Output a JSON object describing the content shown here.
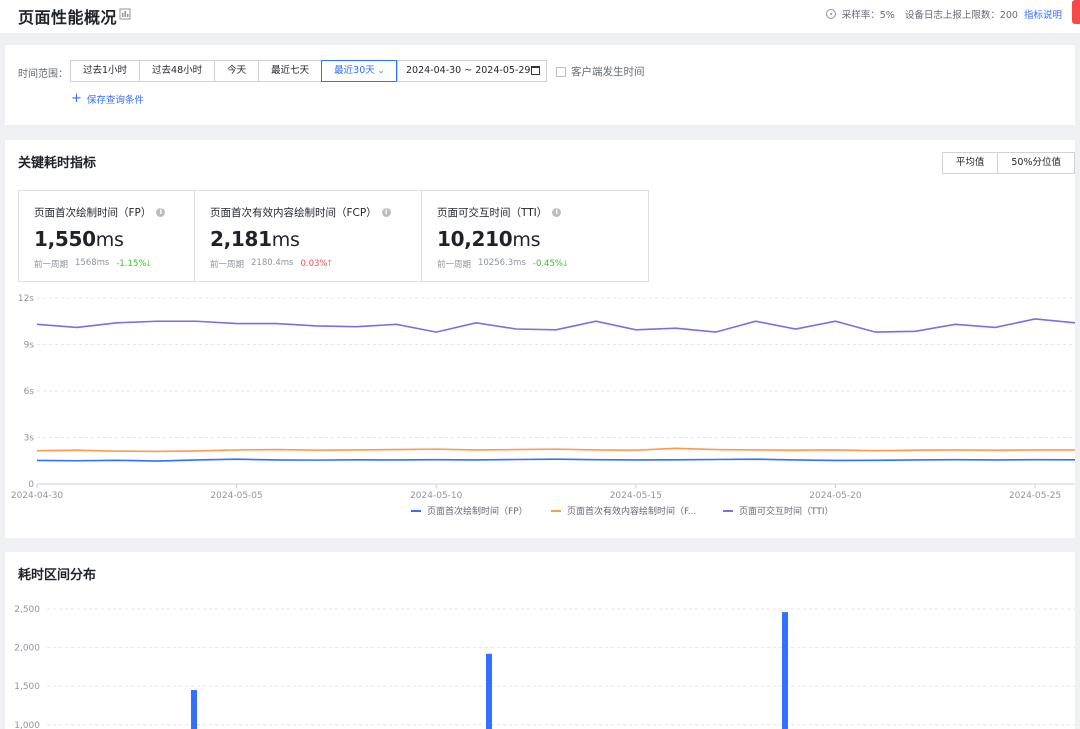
{
  "header": {
    "title": "页面性能概况",
    "sampling": "采样率：5%",
    "device_limit": "设备日志上报上限数：200",
    "metrics_help": "指标说明"
  },
  "filters": {
    "label": "时间范围：",
    "ranges": [
      "过去1小时",
      "过去48小时",
      "今天",
      "最近七天",
      "最近30天"
    ],
    "selected_range": "最近30天",
    "date_range": "2024-04-30 ~ 2024-05-29",
    "client_time_label": "客户端发生时间",
    "client_time_checked": false,
    "save_query": "保存查询条件"
  },
  "key_metrics": {
    "title": "关键耗时指标",
    "stat_options": [
      "平均值",
      "50%分位值"
    ],
    "cards": [
      {
        "title": "页面首次绘制时间（FP）",
        "value": "1,550",
        "unit": "ms",
        "prev_label": "前一周期",
        "prev_value": "1568ms",
        "change": "-1.15%",
        "trend": "down"
      },
      {
        "title": "页面首次有效内容绘制时间（FCP）",
        "value": "2,181",
        "unit": "ms",
        "prev_label": "前一周期",
        "prev_value": "2180.4ms",
        "change": "0.03%",
        "trend": "up"
      },
      {
        "title": "页面可交互时间（TTI）",
        "value": "10,210",
        "unit": "ms",
        "prev_label": "前一周期",
        "prev_value": "10256.3ms",
        "change": "-0.45%",
        "trend": "down"
      }
    ]
  },
  "distribution": {
    "title": "耗时区间分布"
  },
  "colors": {
    "fp": "#3370ff",
    "fcp": "#ff9a4d",
    "tti": "#7a6fe0",
    "bar": "#3370ff",
    "down": "#34c724",
    "up": "#f54a45",
    "accent": "#3370ff"
  },
  "chart_data": [
    {
      "type": "line",
      "x": [
        "2024-04-30",
        "2024-05-01",
        "2024-05-02",
        "2024-05-03",
        "2024-05-04",
        "2024-05-05",
        "2024-05-06",
        "2024-05-07",
        "2024-05-08",
        "2024-05-09",
        "2024-05-10",
        "2024-05-11",
        "2024-05-12",
        "2024-05-13",
        "2024-05-14",
        "2024-05-15",
        "2024-05-16",
        "2024-05-17",
        "2024-05-18",
        "2024-05-19",
        "2024-05-20",
        "2024-05-21",
        "2024-05-22",
        "2024-05-23",
        "2024-05-24",
        "2024-05-25",
        "2024-05-26"
      ],
      "x_tick_labels": [
        "2024-04-30",
        "2024-05-05",
        "2024-05-10",
        "2024-05-15",
        "2024-05-20",
        "2024-05-25"
      ],
      "y_tick_labels": [
        "0",
        "3s",
        "6s",
        "9s",
        "12s"
      ],
      "ylim": [
        0,
        12
      ],
      "y_unit": "s",
      "grid": true,
      "legend_position": "bottom",
      "series": [
        {
          "name": "页面首次绘制时间（FP）",
          "legend_label": "页面首次绘制时间（FP）",
          "color_key": "fp",
          "values": [
            1.52,
            1.5,
            1.53,
            1.48,
            1.55,
            1.6,
            1.55,
            1.54,
            1.56,
            1.55,
            1.57,
            1.55,
            1.58,
            1.6,
            1.57,
            1.55,
            1.56,
            1.58,
            1.6,
            1.55,
            1.52,
            1.53,
            1.55,
            1.57,
            1.55,
            1.57,
            1.56
          ]
        },
        {
          "name": "页面首次有效内容绘制时间（FCP）",
          "legend_label": "页面首次有效内容绘制时间（F...",
          "color_key": "fcp",
          "values": [
            2.15,
            2.18,
            2.12,
            2.1,
            2.13,
            2.2,
            2.22,
            2.18,
            2.2,
            2.22,
            2.25,
            2.2,
            2.22,
            2.25,
            2.2,
            2.18,
            2.3,
            2.22,
            2.2,
            2.18,
            2.2,
            2.15,
            2.18,
            2.2,
            2.18,
            2.2,
            2.2
          ]
        },
        {
          "name": "页面可交互时间（TTI）",
          "legend_label": "页面可交互时间（TTI）",
          "color_key": "tti",
          "values": [
            10.3,
            10.1,
            10.4,
            10.5,
            10.5,
            10.35,
            10.35,
            10.2,
            10.15,
            10.3,
            9.8,
            10.4,
            10.0,
            9.95,
            10.5,
            9.95,
            10.05,
            9.8,
            10.5,
            10.0,
            10.5,
            9.8,
            9.85,
            10.3,
            10.1,
            10.65,
            10.4
          ]
        }
      ]
    },
    {
      "type": "bar",
      "y_tick_labels": [
        "1,000",
        "1,500",
        "2,000",
        "2,500"
      ],
      "ylim": [
        1000,
        2600
      ],
      "grid": true,
      "values": [
        1450,
        1920,
        2460
      ]
    }
  ]
}
